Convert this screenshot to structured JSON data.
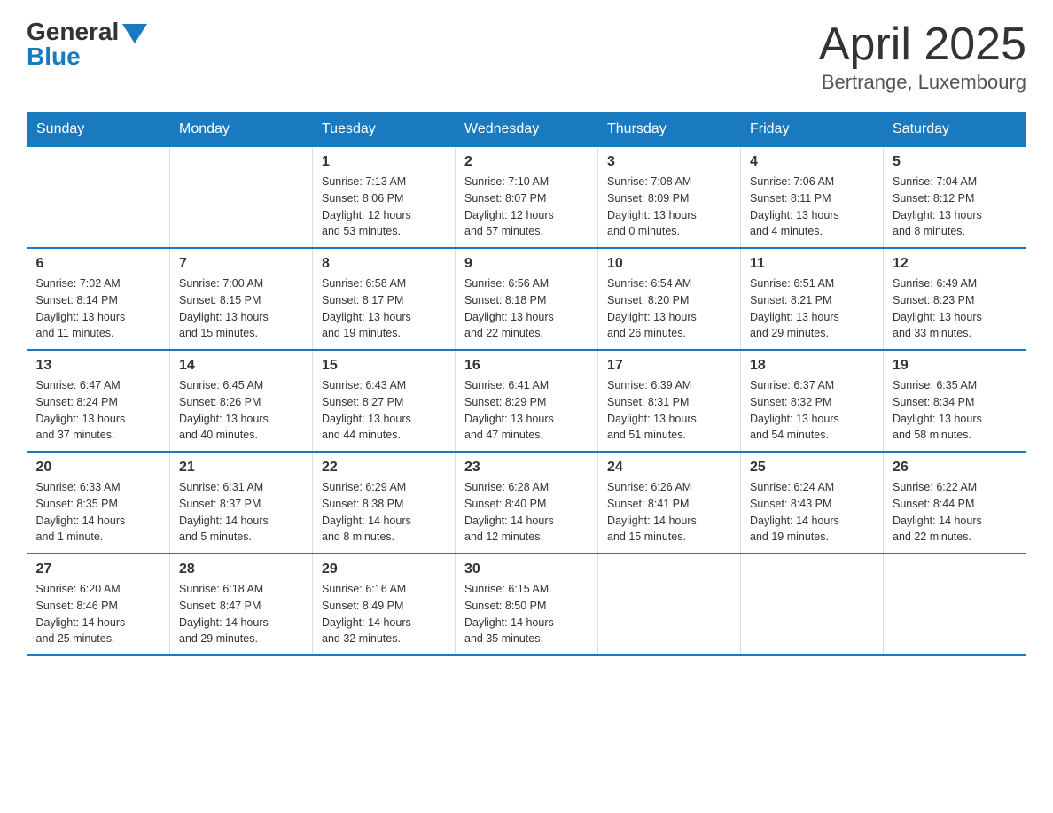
{
  "logo": {
    "general": "General",
    "blue": "Blue"
  },
  "title": "April 2025",
  "subtitle": "Bertrange, Luxembourg",
  "weekdays": [
    "Sunday",
    "Monday",
    "Tuesday",
    "Wednesday",
    "Thursday",
    "Friday",
    "Saturday"
  ],
  "weeks": [
    [
      {
        "day": "",
        "info": ""
      },
      {
        "day": "",
        "info": ""
      },
      {
        "day": "1",
        "info": "Sunrise: 7:13 AM\nSunset: 8:06 PM\nDaylight: 12 hours\nand 53 minutes."
      },
      {
        "day": "2",
        "info": "Sunrise: 7:10 AM\nSunset: 8:07 PM\nDaylight: 12 hours\nand 57 minutes."
      },
      {
        "day": "3",
        "info": "Sunrise: 7:08 AM\nSunset: 8:09 PM\nDaylight: 13 hours\nand 0 minutes."
      },
      {
        "day": "4",
        "info": "Sunrise: 7:06 AM\nSunset: 8:11 PM\nDaylight: 13 hours\nand 4 minutes."
      },
      {
        "day": "5",
        "info": "Sunrise: 7:04 AM\nSunset: 8:12 PM\nDaylight: 13 hours\nand 8 minutes."
      }
    ],
    [
      {
        "day": "6",
        "info": "Sunrise: 7:02 AM\nSunset: 8:14 PM\nDaylight: 13 hours\nand 11 minutes."
      },
      {
        "day": "7",
        "info": "Sunrise: 7:00 AM\nSunset: 8:15 PM\nDaylight: 13 hours\nand 15 minutes."
      },
      {
        "day": "8",
        "info": "Sunrise: 6:58 AM\nSunset: 8:17 PM\nDaylight: 13 hours\nand 19 minutes."
      },
      {
        "day": "9",
        "info": "Sunrise: 6:56 AM\nSunset: 8:18 PM\nDaylight: 13 hours\nand 22 minutes."
      },
      {
        "day": "10",
        "info": "Sunrise: 6:54 AM\nSunset: 8:20 PM\nDaylight: 13 hours\nand 26 minutes."
      },
      {
        "day": "11",
        "info": "Sunrise: 6:51 AM\nSunset: 8:21 PM\nDaylight: 13 hours\nand 29 minutes."
      },
      {
        "day": "12",
        "info": "Sunrise: 6:49 AM\nSunset: 8:23 PM\nDaylight: 13 hours\nand 33 minutes."
      }
    ],
    [
      {
        "day": "13",
        "info": "Sunrise: 6:47 AM\nSunset: 8:24 PM\nDaylight: 13 hours\nand 37 minutes."
      },
      {
        "day": "14",
        "info": "Sunrise: 6:45 AM\nSunset: 8:26 PM\nDaylight: 13 hours\nand 40 minutes."
      },
      {
        "day": "15",
        "info": "Sunrise: 6:43 AM\nSunset: 8:27 PM\nDaylight: 13 hours\nand 44 minutes."
      },
      {
        "day": "16",
        "info": "Sunrise: 6:41 AM\nSunset: 8:29 PM\nDaylight: 13 hours\nand 47 minutes."
      },
      {
        "day": "17",
        "info": "Sunrise: 6:39 AM\nSunset: 8:31 PM\nDaylight: 13 hours\nand 51 minutes."
      },
      {
        "day": "18",
        "info": "Sunrise: 6:37 AM\nSunset: 8:32 PM\nDaylight: 13 hours\nand 54 minutes."
      },
      {
        "day": "19",
        "info": "Sunrise: 6:35 AM\nSunset: 8:34 PM\nDaylight: 13 hours\nand 58 minutes."
      }
    ],
    [
      {
        "day": "20",
        "info": "Sunrise: 6:33 AM\nSunset: 8:35 PM\nDaylight: 14 hours\nand 1 minute."
      },
      {
        "day": "21",
        "info": "Sunrise: 6:31 AM\nSunset: 8:37 PM\nDaylight: 14 hours\nand 5 minutes."
      },
      {
        "day": "22",
        "info": "Sunrise: 6:29 AM\nSunset: 8:38 PM\nDaylight: 14 hours\nand 8 minutes."
      },
      {
        "day": "23",
        "info": "Sunrise: 6:28 AM\nSunset: 8:40 PM\nDaylight: 14 hours\nand 12 minutes."
      },
      {
        "day": "24",
        "info": "Sunrise: 6:26 AM\nSunset: 8:41 PM\nDaylight: 14 hours\nand 15 minutes."
      },
      {
        "day": "25",
        "info": "Sunrise: 6:24 AM\nSunset: 8:43 PM\nDaylight: 14 hours\nand 19 minutes."
      },
      {
        "day": "26",
        "info": "Sunrise: 6:22 AM\nSunset: 8:44 PM\nDaylight: 14 hours\nand 22 minutes."
      }
    ],
    [
      {
        "day": "27",
        "info": "Sunrise: 6:20 AM\nSunset: 8:46 PM\nDaylight: 14 hours\nand 25 minutes."
      },
      {
        "day": "28",
        "info": "Sunrise: 6:18 AM\nSunset: 8:47 PM\nDaylight: 14 hours\nand 29 minutes."
      },
      {
        "day": "29",
        "info": "Sunrise: 6:16 AM\nSunset: 8:49 PM\nDaylight: 14 hours\nand 32 minutes."
      },
      {
        "day": "30",
        "info": "Sunrise: 6:15 AM\nSunset: 8:50 PM\nDaylight: 14 hours\nand 35 minutes."
      },
      {
        "day": "",
        "info": ""
      },
      {
        "day": "",
        "info": ""
      },
      {
        "day": "",
        "info": ""
      }
    ]
  ]
}
